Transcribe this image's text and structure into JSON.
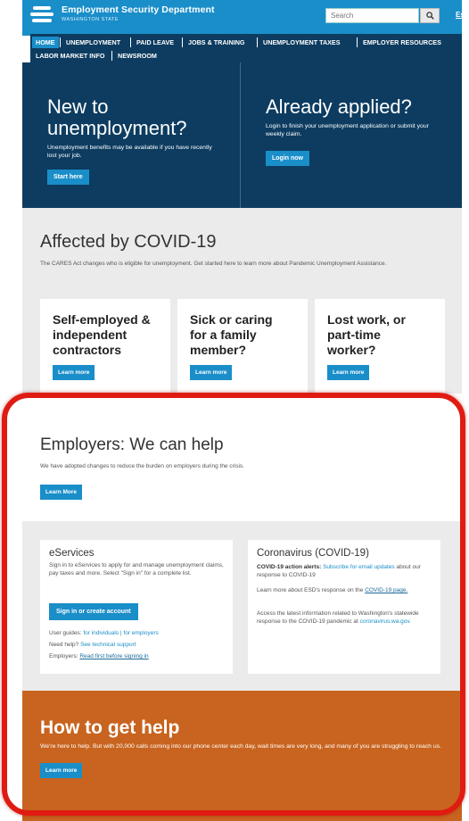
{
  "header": {
    "department": "Employment Security Department",
    "state": "WASHINGTON STATE",
    "search_placeholder": "Search",
    "language_link": "Español"
  },
  "nav": {
    "items": [
      "HOME",
      "UNEMPLOYMENT",
      "PAID LEAVE",
      "JOBS & TRAINING",
      "UNEMPLOYMENT TAXES",
      "EMPLOYER RESOURCES",
      "LABOR MARKET INFO",
      "NEWSROOM"
    ],
    "active": "HOME"
  },
  "hero": {
    "left": {
      "title_line1": "New to",
      "title_line2": "unemployment?",
      "text": "Unemployment benefits may be available if you have recently lost your job.",
      "button": "Start here"
    },
    "right": {
      "title": "Already applied?",
      "text": "Login to finish your unemployment application or submit your weekly claim.",
      "button": "Login now"
    }
  },
  "covid": {
    "title": "Affected by COVID-19",
    "subtitle": "The CARES Act changes who is eligible for unemployment. Get started here to learn more about Pandemic Unemployment Assistance.",
    "cards": [
      {
        "line1": "Self-employed &",
        "line2": "independent",
        "line3": "contractors",
        "button": "Learn more"
      },
      {
        "line1": "Sick or caring",
        "line2": "for a family",
        "line3": "member?",
        "button": "Learn more"
      },
      {
        "line1": "Lost work, or",
        "line2": "part-time",
        "line3": "worker?",
        "button": "Learn more"
      }
    ]
  },
  "employers": {
    "title": "Employers: We can help",
    "subtitle": "We have adopted changes to reduce the burden on employers during the crisis.",
    "button": "Learn More"
  },
  "eservices": {
    "title": "eServices",
    "text": "Sign in to eServices to apply for and manage unemployment claims, pay taxes and more. Select \"Sign in\" for a complete list.",
    "button": "Sign in or create account",
    "guides_label": "User guides:",
    "guides_individuals": "for individuals",
    "guides_sep": "|",
    "guides_employers": "for employers",
    "help_label": "Need help?",
    "help_link": "See technical support",
    "employers_label": "Employers:",
    "employers_link": "Read first before signing in"
  },
  "coronavirus": {
    "title": "Coronavirus (COVID-19)",
    "alerts_label": "COVID-19 action alerts:",
    "alerts_link": "Subscribe for email updates",
    "alerts_rest": "about our response to COVID-19",
    "learn_text": "Learn more about ESD's response on the",
    "learn_link": "COVID-19 page.",
    "access_text": "Access the latest information related to Washington's statewide response to the COVID-19 pandemic at",
    "access_link": "coronavirus.wa.gov."
  },
  "help": {
    "title": "How to get help",
    "text": "We're here to help. But with 20,000 calls coming into our phone center each day, wait times are very long, and many of you are struggling to reach us.",
    "button": "Learn more"
  }
}
